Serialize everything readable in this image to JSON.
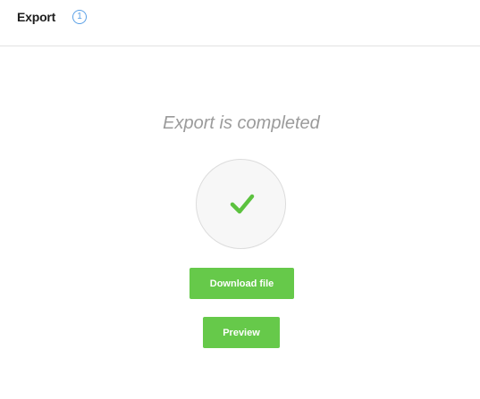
{
  "header": {
    "title": "Export",
    "step_badge": "1"
  },
  "main": {
    "status_text": "Export is completed",
    "status_icon": "checkmark-icon",
    "download_button_label": "Download file",
    "preview_button_label": "Preview"
  },
  "colors": {
    "accent_green": "#66c94a",
    "badge_blue": "#5aa0e6",
    "status_gray": "#9b9b9b"
  }
}
